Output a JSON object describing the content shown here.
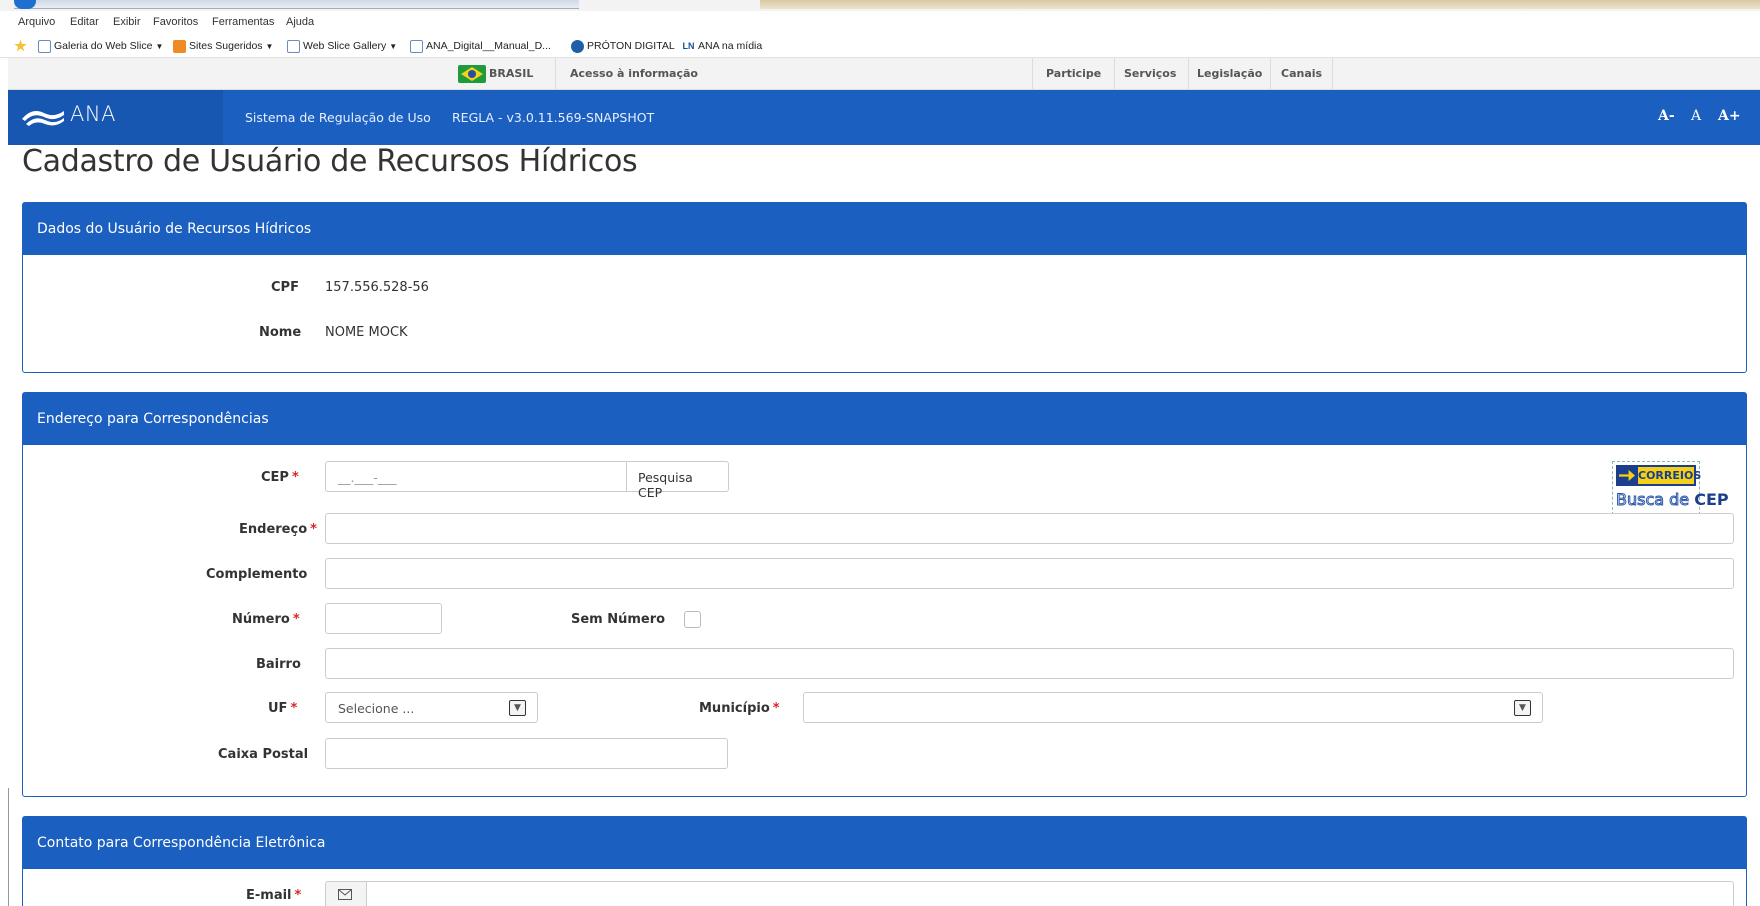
{
  "browser": {
    "menu": [
      "Arquivo",
      "Editar",
      "Exibir",
      "Favoritos",
      "Ferramentas",
      "Ajuda"
    ],
    "favorites": [
      {
        "label": "Galeria do Web Slice",
        "icon": "ie-page-icon",
        "dropdown": true
      },
      {
        "label": "Sites Sugeridos",
        "icon": "rss-icon",
        "dropdown": true
      },
      {
        "label": "Web Slice Gallery",
        "icon": "ie-page-icon",
        "dropdown": true
      },
      {
        "label": "ANA_Digital__Manual_D...",
        "icon": "ie-page-icon",
        "dropdown": false
      },
      {
        "label": "PRÓTON DIGITAL",
        "icon": "shield-icon",
        "dropdown": false
      },
      {
        "label": "ANA na mídia",
        "icon": "ln-icon",
        "dropdown": false
      }
    ]
  },
  "govbar": {
    "brasil": "BRASIL",
    "acesso": "Acesso à informação",
    "links": [
      "Participe",
      "Serviços",
      "Legislação",
      "Canais"
    ]
  },
  "header": {
    "logo_text": "ANA",
    "system_name": "Sistema de Regulação de Uso",
    "version": "REGLA - v3.0.11.569-SNAPSHOT",
    "font_controls": {
      "decrease": "A-",
      "reset": "A",
      "increase": "A+"
    }
  },
  "page_title": "Cadastro de Usuário de Recursos Hídricos",
  "panel_dados": {
    "title": "Dados do Usuário de Recursos Hídricos",
    "cpf_label": "CPF",
    "cpf_value": "157.556.528-56",
    "nome_label": "Nome",
    "nome_value": "NOME MOCK"
  },
  "panel_endereco": {
    "title": "Endereço para Correspondências",
    "cep_label": "CEP",
    "cep_placeholder": "__.___-___",
    "cep_button": "Pesquisa CEP",
    "correios_top": "CORREIOS",
    "correios_busca": "Busca de",
    "correios_cep": "CEP",
    "endereco_label": "Endereço",
    "complemento_label": "Complemento",
    "numero_label": "Número",
    "sem_numero_label": "Sem Número",
    "bairro_label": "Bairro",
    "uf_label": "UF",
    "uf_value": "Selecione ...",
    "municipio_label": "Município",
    "caixa_postal_label": "Caixa Postal",
    "required_mark": "*"
  },
  "panel_contato": {
    "title": "Contato para Correspondência Eletrônica",
    "email_label": "E-mail"
  },
  "colors": {
    "primary": "#1b5fc1",
    "required": "#d9262a"
  }
}
